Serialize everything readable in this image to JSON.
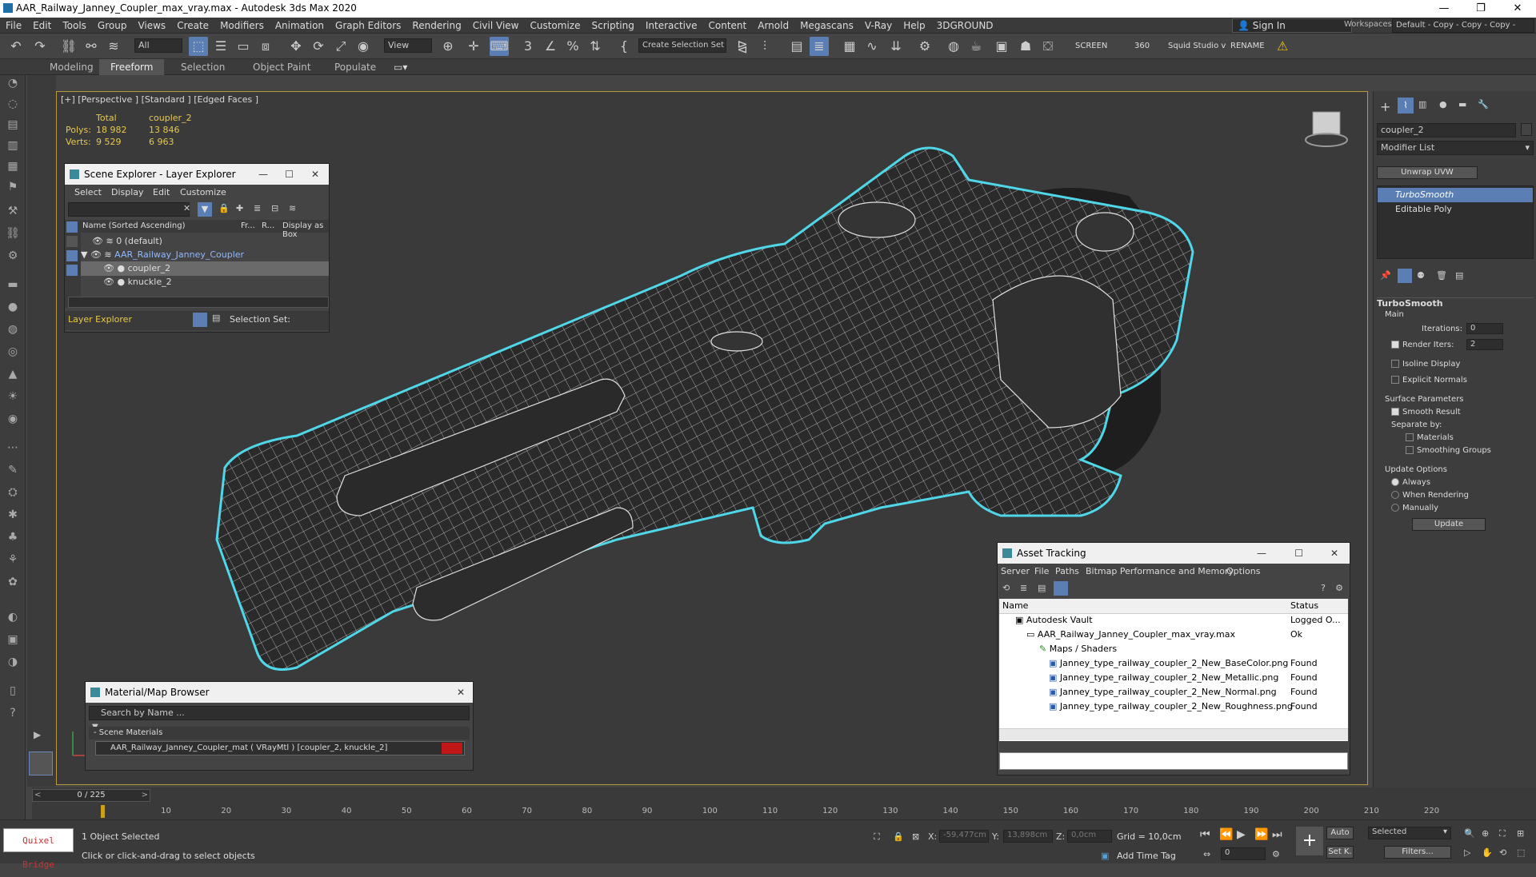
{
  "window": {
    "title": "AAR_Railway_Janney_Coupler_max_vray.max - Autodesk 3ds Max 2020"
  },
  "menu": [
    "File",
    "Edit",
    "Tools",
    "Group",
    "Views",
    "Create",
    "Modifiers",
    "Animation",
    "Graph Editors",
    "Rendering",
    "Civil View",
    "Customize",
    "Scripting",
    "Interactive",
    "Content",
    "Arnold",
    "Megascans",
    "V-Ray",
    "Help",
    "3DGROUND"
  ],
  "signin": "Sign In",
  "workspaces": {
    "label": "Workspaces:",
    "value": "Default - Copy - Copy - Copy - Copy"
  },
  "toolbar": {
    "filter": "All",
    "refcoord": "View",
    "selset": "Create Selection Set",
    "screen": "SCREEN",
    "num360": "360",
    "squid": "Squid Studio v",
    "rename": "RENAME"
  },
  "ribbon": [
    "Modeling",
    "Freeform",
    "Selection",
    "Object Paint",
    "Populate"
  ],
  "viewport": {
    "label": "[+] [Perspective ] [Standard ] [Edged Faces ]",
    "stats": {
      "h1": "Total",
      "h2": "coupler_2",
      "polys_label": "Polys:",
      "polys_total": "18 982",
      "polys_obj": "13 846",
      "verts_label": "Verts:",
      "verts_total": "9 529",
      "verts_obj": "6 963"
    }
  },
  "scene_explorer": {
    "title": "Scene Explorer - Layer Explorer",
    "menu": [
      "Select",
      "Display",
      "Edit",
      "Customize"
    ],
    "cols": [
      "Name (Sorted Ascending)",
      "Fr...",
      "R...",
      "Display as Box"
    ],
    "rows": [
      "0 (default)",
      "AAR_Railway_Janney_Coupler",
      "coupler_2",
      "knuckle_2"
    ],
    "footer": "Layer Explorer",
    "selset": "Selection Set:"
  },
  "material_browser": {
    "title": "Material/Map Browser",
    "search": "Search by Name ...",
    "section": "- Scene Materials",
    "item": "AAR_Railway_Janney_Coupler_mat  ( VRayMtl )  [coupler_2, knuckle_2]"
  },
  "asset_tracking": {
    "title": "Asset Tracking",
    "menu": [
      "Server",
      "File",
      "Paths",
      "Bitmap Performance and Memory",
      "Options"
    ],
    "cols": [
      "Name",
      "Status"
    ],
    "rows": [
      {
        "name": "Autodesk Vault",
        "status": "Logged O..."
      },
      {
        "name": "AAR_Railway_Janney_Coupler_max_vray.max",
        "status": "Ok"
      },
      {
        "name": "Maps / Shaders",
        "status": ""
      },
      {
        "name": "Janney_type_railway_coupler_2_New_BaseColor.png",
        "status": "Found"
      },
      {
        "name": "Janney_type_railway_coupler_2_New_Metallic.png",
        "status": "Found"
      },
      {
        "name": "Janney_type_railway_coupler_2_New_Normal.png",
        "status": "Found"
      },
      {
        "name": "Janney_type_railway_coupler_2_New_Roughness.png",
        "status": "Found"
      }
    ]
  },
  "command_panel": {
    "object": "coupler_2",
    "modlist": "Modifier List",
    "unwrap": "Unwrap UVW",
    "stack": [
      "TurboSmooth",
      "Editable Poly"
    ],
    "rollout": "TurboSmooth",
    "main": "Main",
    "iter_label": "Iterations:",
    "iter_val": "0",
    "render_label": "Render Iters:",
    "render_val": "2",
    "isoline": "Isoline Display",
    "explicit": "Explicit Normals",
    "surface": "Surface Parameters",
    "smooth": "Smooth Result",
    "sepby": "Separate by:",
    "materials": "Materials",
    "smgroups": "Smoothing Groups",
    "update_opts": "Update Options",
    "always": "Always",
    "when": "When Rendering",
    "manually": "Manually",
    "update_btn": "Update"
  },
  "timeline": {
    "frame": "0 / 225",
    "ticks": [
      "10",
      "20",
      "30",
      "40",
      "50",
      "60",
      "70",
      "80",
      "90",
      "100",
      "110",
      "120",
      "130",
      "140",
      "150",
      "160",
      "170",
      "180",
      "190",
      "200",
      "210",
      "220"
    ]
  },
  "status": {
    "selected": "1 Object Selected",
    "prompt": "Click or click-and-drag to select objects",
    "x_label": "X:",
    "x": "-59,477cm",
    "y_label": "Y:",
    "y": "13,898cm",
    "z_label": "Z:",
    "z": "0,0cm",
    "grid": "Grid = 10,0cm",
    "timetag": "Add Time Tag",
    "auto": "Auto",
    "setk": "Set K.",
    "selected_dd": "Selected",
    "filters": "Filters...",
    "frame_field": "0",
    "quixel": "Quixel Bridge"
  }
}
